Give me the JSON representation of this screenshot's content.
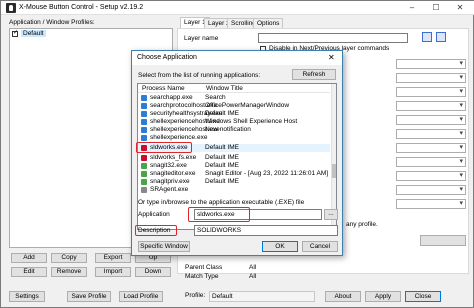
{
  "window": {
    "title": "X-Mouse Button Control - Setup v2.19.2",
    "minimize": "–",
    "maximize": "☐",
    "close": "✕"
  },
  "profiles": {
    "header": "Application / Window Profiles:",
    "items": [
      {
        "label": "Default",
        "checked": true
      }
    ]
  },
  "tabs": [
    "Layer 1",
    "Layer 2",
    "Scrolling",
    "Options"
  ],
  "layer": {
    "name_label": "Layer name",
    "disable_label": "Disable in Next/Previous layer commands"
  },
  "side_text": {
    "any_profile": "any profile."
  },
  "buttons": {
    "add": "Add",
    "copy": "Copy",
    "export": "Export",
    "edit": "Edit",
    "remove": "Remove",
    "import": "Import",
    "up": "Up",
    "down": "Down",
    "settings": "Settings",
    "save_profile": "Save Profile",
    "load_profile": "Load Profile",
    "about": "About",
    "apply": "Apply",
    "close": "Close"
  },
  "info": {
    "parent_class_label": "Parent Class",
    "parent_class_value": "All",
    "match_type_label": "Match Type",
    "match_type_value": "All",
    "profile_label": "Profile:",
    "profile_value": "Default"
  },
  "dialog": {
    "title": "Choose Application",
    "instruction": "Select from the list of running applications:",
    "refresh": "Refresh",
    "columns": [
      "Process Name",
      "Window Title"
    ],
    "rows": [
      {
        "process": "searchapp.exe",
        "title": "Search"
      },
      {
        "process": "searchprotocolhost.exe",
        "title": "OfficePowerManagerWindow"
      },
      {
        "process": "securityhealthsystray.exe",
        "title": "Default IME"
      },
      {
        "process": "shellexperiencehost.exe",
        "title": "Windows Shell Experience Host"
      },
      {
        "process": "shellexperiencehost.exe",
        "title": "New notification"
      },
      {
        "process": "shellexperience.exe",
        "title": ""
      },
      {
        "process": "sldworks.exe",
        "title": "Default IME"
      },
      {
        "process": "sldworks_fs.exe",
        "title": "Default IME"
      },
      {
        "process": "snagit32.exe",
        "title": "Default IME"
      },
      {
        "process": "snagiteditor.exe",
        "title": "Snagit Editor - [Aug 23, 2022 11:26:01 AM]"
      },
      {
        "process": "snagitpriv.exe",
        "title": "Default IME"
      },
      {
        "process": "SRAgent.exe",
        "title": ""
      }
    ],
    "browse_text": "Or type in/browse to the application executable (.EXE) file",
    "application_label": "Application",
    "application_value": "sldworks.exe",
    "browse_button": "...",
    "description_label": "Description",
    "description_value": "SOLIDWORKS",
    "specific_window": "Specific Window",
    "ok": "OK",
    "cancel": "Cancel"
  },
  "colors": {
    "highlight": "#e0242b",
    "accent": "#0078d7"
  }
}
